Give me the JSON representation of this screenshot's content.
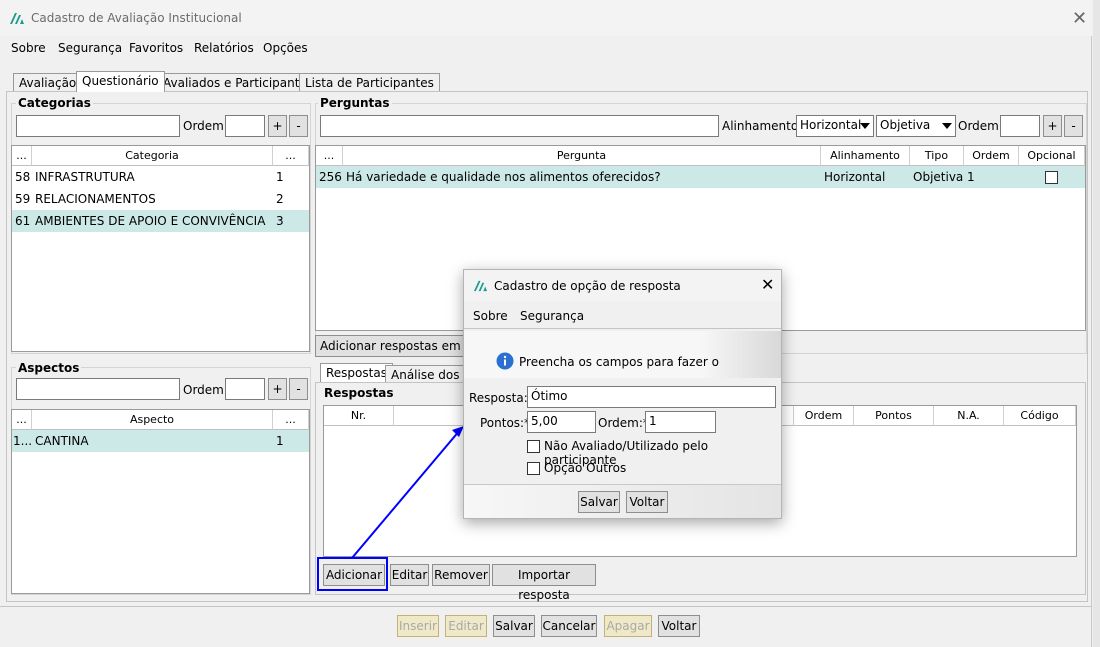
{
  "window": {
    "title": "Cadastro de Avaliação Institucional",
    "close": "✕"
  },
  "menu": [
    "Sobre",
    "Segurança",
    "Favoritos",
    "Relatórios",
    "Opções"
  ],
  "tabs": [
    "Avaliação",
    "Questionário",
    "Avaliados e Participantes",
    "Lista de Participantes"
  ],
  "categorias": {
    "label": "Categorias",
    "ordem_label": "Ordem:",
    "plus": "+",
    "minus": "-",
    "headers": [
      "...",
      "Categoria",
      "..."
    ],
    "rows": [
      {
        "id": "58",
        "name": "INFRASTRUTURA",
        "ord": "1"
      },
      {
        "id": "59",
        "name": "RELACIONAMENTOS",
        "ord": "2"
      },
      {
        "id": "61",
        "name": "AMBIENTES DE APOIO E CONVIVÊNCIA",
        "ord": "3"
      }
    ]
  },
  "perguntas": {
    "label": "Perguntas",
    "alinhamento_label": "Alinhamento:",
    "alinhamento_value": "Horizontal",
    "tipo_value": "Objetiva",
    "ordem_label": "Ordem:",
    "plus": "+",
    "minus": "-",
    "headers": [
      "...",
      "Pergunta",
      "Alinhamento",
      "Tipo",
      "Ordem",
      "Opcional"
    ],
    "rows": [
      {
        "id": "256",
        "text": "Há variedade e qualidade nos alimentos oferecidos?",
        "alin": "Horizontal",
        "tipo": "Objetiva",
        "ord": "1"
      }
    ],
    "add_answers_button": "Adicionar respostas em lote"
  },
  "aspectos": {
    "label": "Aspectos",
    "ordem_label": "Ordem:",
    "plus": "+",
    "minus": "-",
    "headers": [
      "...",
      "Aspecto",
      "..."
    ],
    "rows": [
      {
        "id": "1...",
        "name": "CANTINA",
        "ord": "1"
      }
    ]
  },
  "respostas": {
    "tabs": [
      "Respostas",
      "Análise dos da"
    ],
    "label": "Respostas",
    "headers": [
      "Nr.",
      "Ordem",
      "Pontos",
      "N.A.",
      "Código"
    ],
    "buttons": [
      "Adicionar",
      "Editar",
      "Remover",
      "Importar resposta"
    ]
  },
  "bottom_buttons": [
    "Inserir",
    "Editar",
    "Salvar",
    "Cancelar",
    "Apagar",
    "Voltar"
  ],
  "dialog": {
    "title": "Cadastro de opção de resposta",
    "close": "✕",
    "menu": [
      "Sobre",
      "Segurança"
    ],
    "info": "Preencha os campos para fazer o cada",
    "resposta_label": "Resposta:*",
    "resposta_value": "Ótimo",
    "pontos_label": "Pontos:*",
    "pontos_value": "5,00",
    "ordem_label": "Ordem:*",
    "ordem_value": "1",
    "chk1": "Não Avaliado/Utilizado pelo participante",
    "chk2": "Opção Outros",
    "salvar": "Salvar",
    "voltar": "Voltar"
  },
  "colors": {
    "selection": "#cde9e7",
    "annotation": "#0000ff",
    "disabled_bg": "#f0e9c8"
  }
}
